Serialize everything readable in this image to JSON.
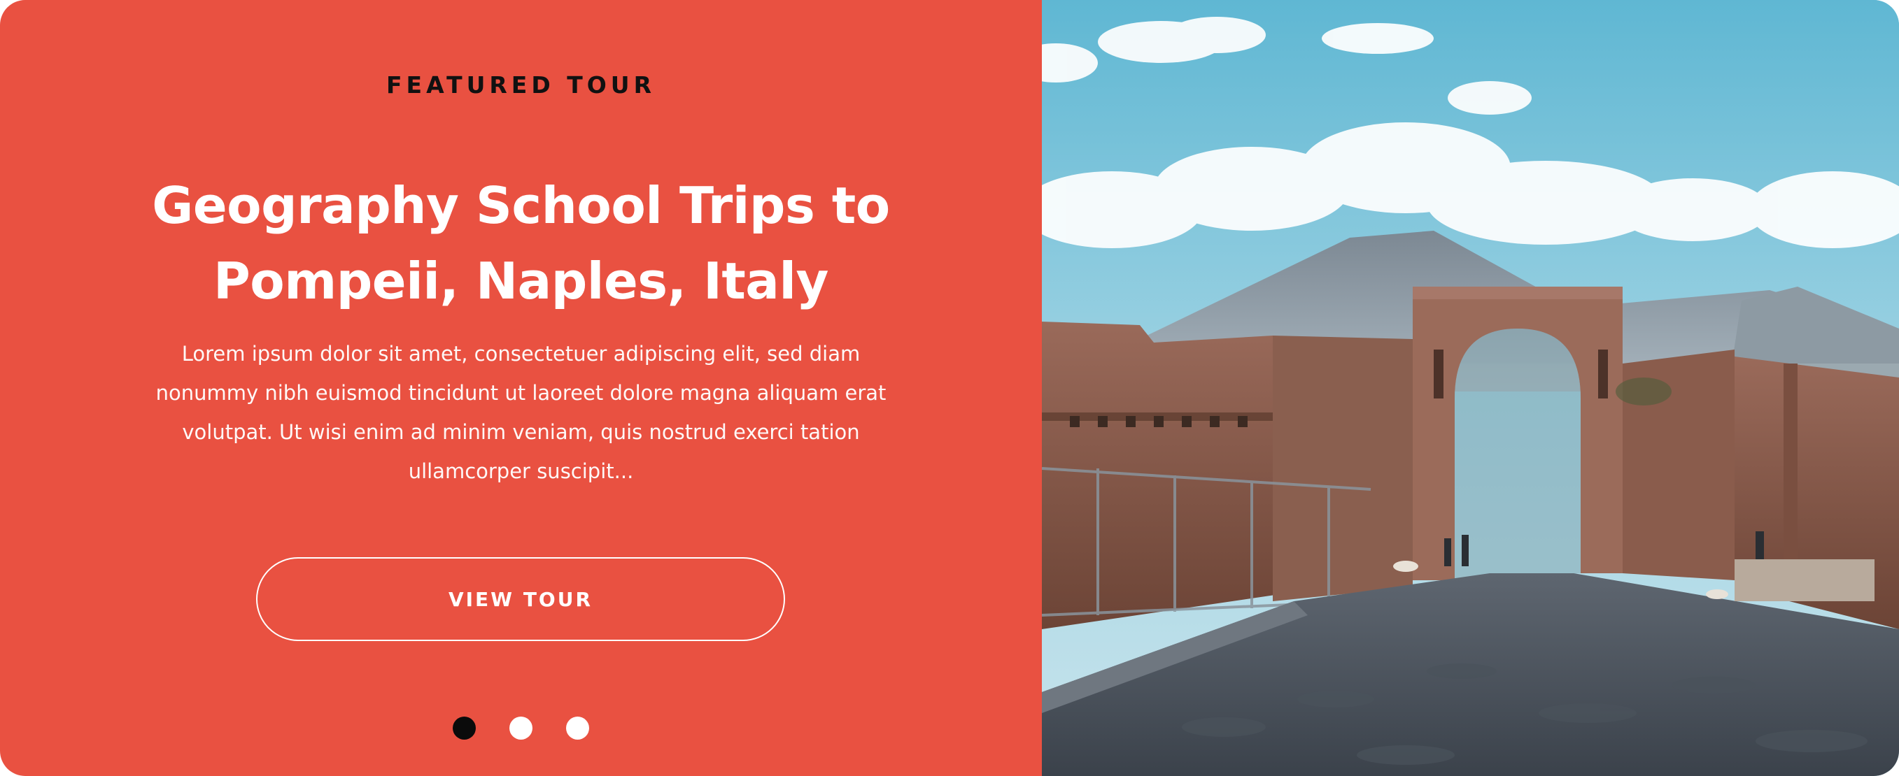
{
  "tour": {
    "eyebrow": "FEATURED TOUR",
    "title_line1": "Geography School Trips to",
    "title_line2": "Pompeii, Naples, Italy",
    "description": "Lorem ipsum dolor sit amet, consectetuer adipiscing elit, sed diam nonummy nibh euismod tincidunt ut laoreet dolore magna aliquam erat volutpat. Ut wisi enim ad minim veniam, quis nostrud exerci tation ullamcorper suscipit...",
    "cta_label": "VIEW TOUR"
  },
  "carousel": {
    "total_slides": 3,
    "active_index": 0
  },
  "colors": {
    "panel_background": "#e95141",
    "text_light": "#ffffff",
    "eyebrow_text": "#111111",
    "dot_active": "#0b0b0b",
    "dot_inactive": "#ffffff"
  },
  "image": {
    "subject": "pompeii-ruins-arch-with-vesuvius"
  }
}
